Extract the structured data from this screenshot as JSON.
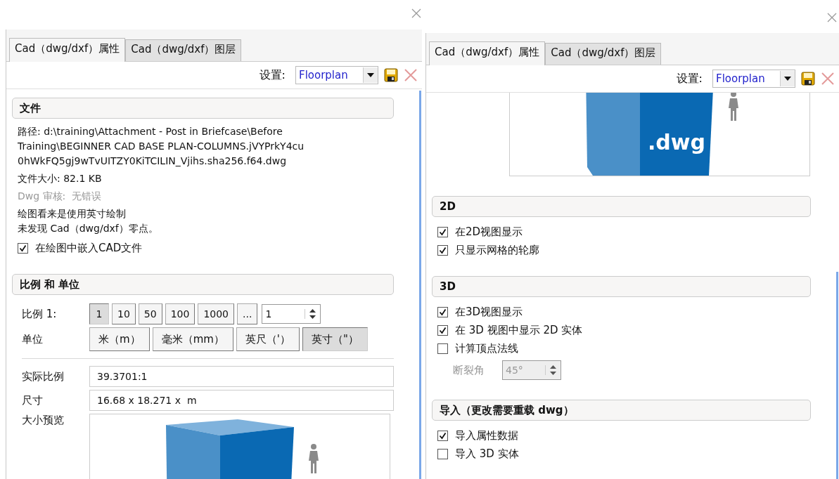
{
  "panels": [
    {
      "tabs": [
        {
          "label": "Cad（dwg/dxf）属性",
          "selected": true
        },
        {
          "label": "Cad（dwg/dxf）图层",
          "selected": false
        }
      ],
      "settings": {
        "label": "设置:",
        "value": "Floorplan"
      },
      "sections": [
        {
          "title": "文件",
          "items": [
            {
              "kind": "paragraph",
              "lines": [
                "路径: d:\\training\\Attachment - Post in Briefcase\\Before",
                "Training\\BEGINNER CAD BASE PLAN-COLUMNS.jVYPrkY4cu",
                "0hWkFQ5gj9wTvUITZY0KiTCILIN_Vjihs.sha256.f64.dwg"
              ],
              "disabled": false
            },
            {
              "kind": "paragraph",
              "lines": [
                "文件大小: 82.1 KB"
              ],
              "disabled": false
            },
            {
              "kind": "paragraph",
              "lines": [
                "Dwg 审核:  无错误"
              ],
              "disabled": true
            },
            {
              "kind": "paragraph",
              "lines": [
                "绘图看来是使用英寸绘制",
                "未发现 Cad（dwg/dxf）零点。"
              ],
              "disabled": false
            },
            {
              "kind": "checkbox",
              "label": "在绘图中嵌入CAD文件",
              "checked": true
            }
          ]
        },
        {
          "title": "比例 和 单位",
          "items": [
            {
              "kind": "buttons",
              "label": "比例 1:",
              "buttons": [
                {
                  "label": "1",
                  "selected": true
                },
                {
                  "label": "10",
                  "selected": false
                },
                {
                  "label": "50",
                  "selected": false
                },
                {
                  "label": "100",
                  "selected": false
                },
                {
                  "label": "1000",
                  "selected": false
                },
                {
                  "label": "...",
                  "selected": false
                }
              ],
              "spinner": "1"
            },
            {
              "kind": "buttons",
              "label": "单位",
              "buttons": [
                {
                  "label": "米（m）",
                  "selected": false
                },
                {
                  "label": "毫米（mm）",
                  "selected": false
                },
                {
                  "label": "英尺（'）",
                  "selected": false
                },
                {
                  "label": "英寸（\"）",
                  "selected": true
                }
              ]
            },
            {
              "kind": "divider"
            },
            {
              "kind": "field",
              "label": "实际比例",
              "value": "39.3701:1"
            },
            {
              "kind": "field",
              "label": "尺寸",
              "value": "16.68 x 18.271 x  m"
            },
            {
              "kind": "preview",
              "label": "大小预览"
            }
          ]
        }
      ]
    },
    {
      "tabs": [
        {
          "label": "Cad（dwg/dxf）属性",
          "selected": true
        },
        {
          "label": "Cad（dwg/dxf）图层",
          "selected": false
        }
      ],
      "settings": {
        "label": "设置:",
        "value": "Floorplan"
      },
      "sections": [
        {
          "items": [
            {
              "kind": "preview",
              "badge": ".dwg"
            }
          ]
        },
        {
          "title": "2D",
          "items": [
            {
              "kind": "checkbox",
              "label": "在2D视图显示",
              "checked": true
            },
            {
              "kind": "checkbox",
              "label": "只显示网格的轮廓",
              "checked": true
            }
          ]
        },
        {
          "title": "3D",
          "items": [
            {
              "kind": "checkbox",
              "label": "在3D视图显示",
              "checked": true
            },
            {
              "kind": "checkbox",
              "label": "在 3D 视图中显示 2D 实体",
              "checked": true
            },
            {
              "kind": "checkbox",
              "label": "计算顶点法线",
              "checked": false
            },
            {
              "kind": "spinner",
              "label": "断裂角",
              "value": "45°",
              "disabled": true
            }
          ]
        },
        {
          "title": "导入（更改需要重载 dwg）",
          "items": [
            {
              "kind": "checkbox",
              "label": "导入属性数据",
              "checked": true
            },
            {
              "kind": "checkbox",
              "label": "导入 3D 实体",
              "checked": false
            }
          ]
        }
      ]
    }
  ]
}
